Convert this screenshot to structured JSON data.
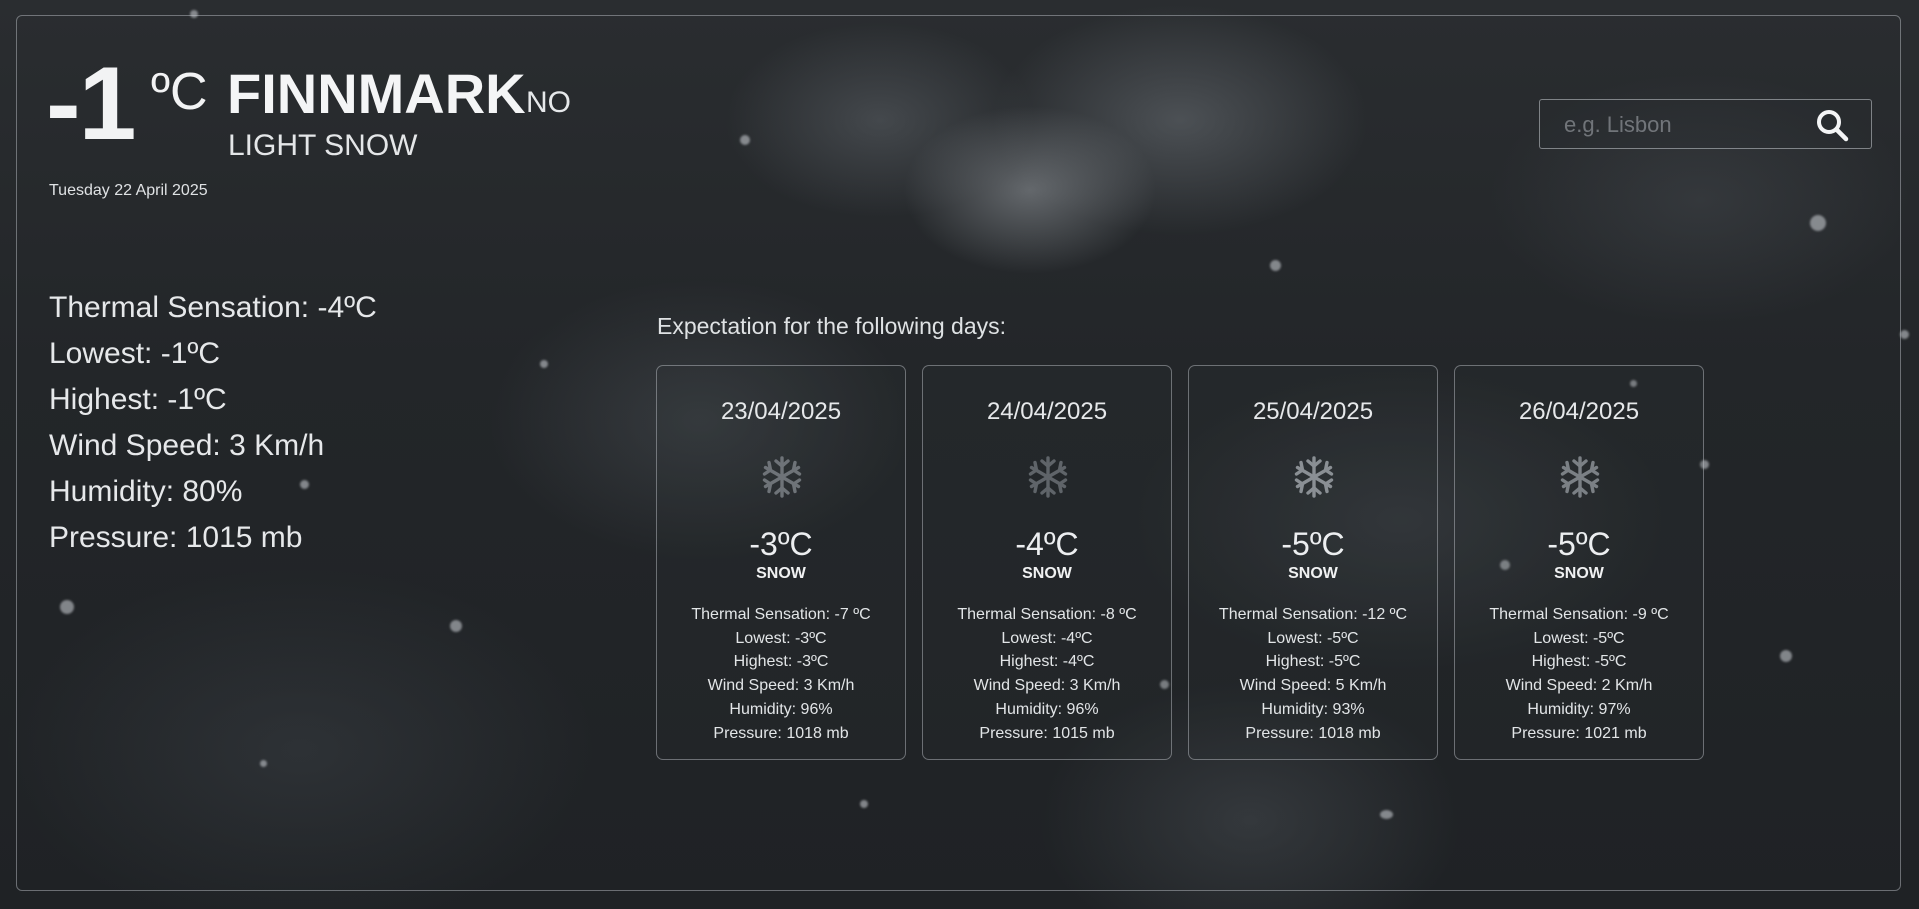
{
  "current": {
    "temp": "-1",
    "unit": "ºC",
    "city": "FINNMARK",
    "country": "NO",
    "condition": "LIGHT SNOW",
    "date": "Tuesday 22 April 2025",
    "details": [
      "Thermal Sensation: -4ºC",
      "Lowest: -1ºC",
      "Highest: -1ºC",
      "Wind Speed: 3 Km/h",
      "Humidity: 80%",
      "Pressure: 1015 mb"
    ]
  },
  "search": {
    "placeholder": "e.g. Lisbon",
    "icon": "search-icon"
  },
  "forecast": {
    "title": "Expectation for the following days:",
    "days": [
      {
        "date": "23/04/2025",
        "icon": "snowflake-icon",
        "temp": "-3ºC",
        "condition": "SNOW",
        "details": [
          "Thermal Sensation: -7 ºC",
          "Lowest: -3ºC",
          "Highest: -3ºC",
          "Wind Speed: 3 Km/h",
          "Humidity: 96%",
          "Pressure: 1018 mb"
        ]
      },
      {
        "date": "24/04/2025",
        "icon": "snowflake-icon",
        "temp": "-4ºC",
        "condition": "SNOW",
        "details": [
          "Thermal Sensation: -8 ºC",
          "Lowest: -4ºC",
          "Highest: -4ºC",
          "Wind Speed: 3 Km/h",
          "Humidity: 96%",
          "Pressure: 1015 mb"
        ]
      },
      {
        "date": "25/04/2025",
        "icon": "snowflake-icon",
        "temp": "-5ºC",
        "condition": "SNOW",
        "details": [
          "Thermal Sensation: -12 ºC",
          "Lowest: -5ºC",
          "Highest: -5ºC",
          "Wind Speed: 5 Km/h",
          "Humidity: 93%",
          "Pressure: 1018 mb"
        ]
      },
      {
        "date": "26/04/2025",
        "icon": "snowflake-icon",
        "temp": "-5ºC",
        "condition": "SNOW",
        "details": [
          "Thermal Sensation: -9 ºC",
          "Lowest: -5ºC",
          "Highest: -5ºC",
          "Wind Speed: 2 Km/h",
          "Humidity: 97%",
          "Pressure: 1021 mb"
        ]
      }
    ]
  }
}
